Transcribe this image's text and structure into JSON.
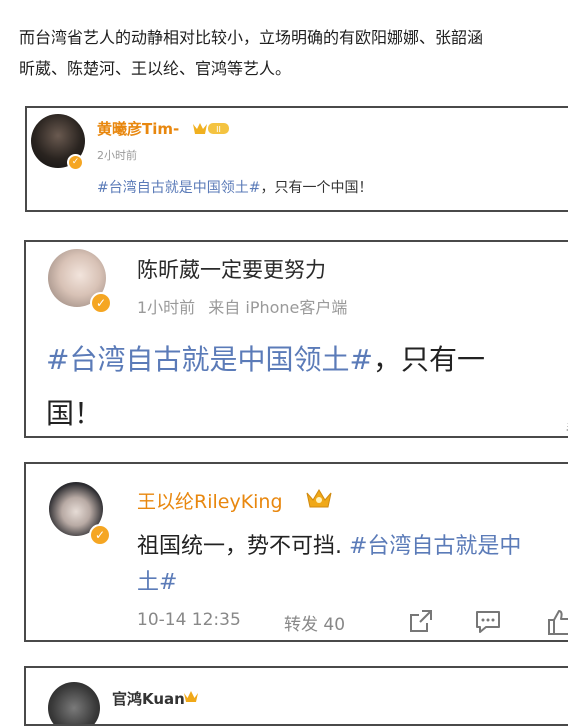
{
  "article": {
    "line1": "而台湾省艺人的动静相对比较小，立场明确的有欧阳娜娜、张韶涵",
    "line2": "昕葳、陈楚河、王以纶、官鸿等艺人。"
  },
  "colors": {
    "tag_blue": "#5b7bb8",
    "meta_gray": "#9a9a9a",
    "verified_orange": "#f5a623",
    "name_orange": "#e8870e",
    "border": "#4a4a4a"
  },
  "posts": [
    {
      "author": "黄曦彦Tim-",
      "time": "2小时前",
      "hashtag": "#台湾自古就是中国领土#",
      "text_rest": "，只有一个中国！",
      "level_badge": "II"
    },
    {
      "author": "陈昕葳一定要更努力",
      "time": "1小时前",
      "source": "来自 iPhone客户端",
      "hashtag": "#台湾自古就是中国领土#",
      "text_rest": "，只有一",
      "text_line2": "国！",
      "cut_glyph": "手"
    },
    {
      "author": "王以纶RileyKing",
      "text_lead": "祖国统一，势不可挡. ",
      "hashtag_line1": "#台湾自古就是中",
      "hashtag_line2": "土#",
      "time": "10-14 12:35",
      "repost": "转发 40"
    },
    {
      "author": "官鸿Kuan"
    }
  ]
}
